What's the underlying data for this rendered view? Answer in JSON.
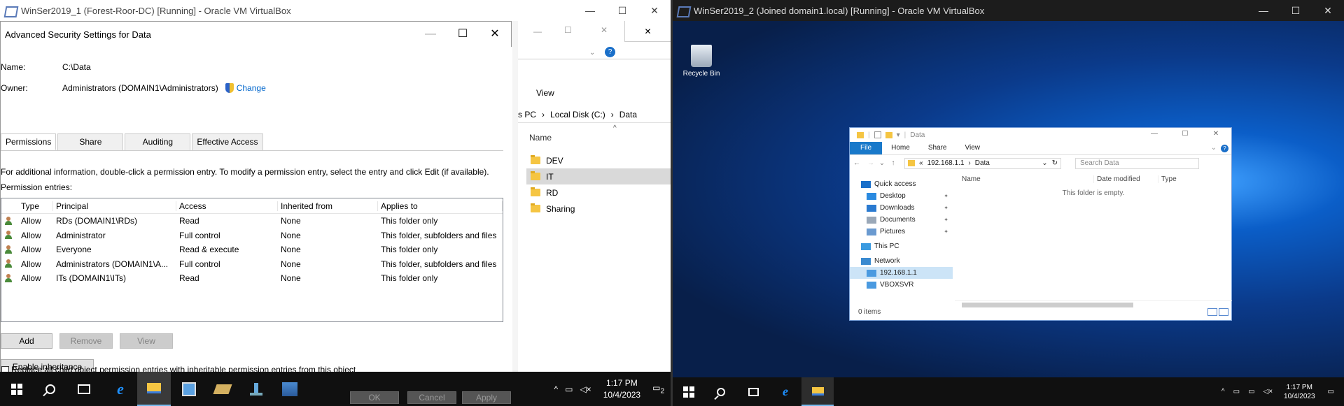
{
  "vm1": {
    "title": "WinSer2019_1 (Forest-Roor-DC) [Running] - Oracle VM VirtualBox",
    "dialog": {
      "title": "Advanced Security Settings for Data",
      "name_label": "Name:",
      "name_value": "C:\\Data",
      "owner_label": "Owner:",
      "owner_value": "Administrators (DOMAIN1\\Administrators)",
      "change_link": "Change",
      "tabs": [
        "Permissions",
        "Share",
        "Auditing",
        "Effective Access"
      ],
      "info_text": "For additional information, double-click a permission entry. To modify a permission entry, select the entry and click Edit (if available).",
      "entries_label": "Permission entries:",
      "columns": [
        "Type",
        "Principal",
        "Access",
        "Inherited from",
        "Applies to"
      ],
      "rows": [
        {
          "type": "Allow",
          "principal": "RDs (DOMAIN1\\RDs)",
          "access": "Read",
          "inherited": "None",
          "applies": "This folder only"
        },
        {
          "type": "Allow",
          "principal": "Administrator",
          "access": "Full control",
          "inherited": "None",
          "applies": "This folder, subfolders and files"
        },
        {
          "type": "Allow",
          "principal": "Everyone",
          "access": "Read & execute",
          "inherited": "None",
          "applies": "This folder only"
        },
        {
          "type": "Allow",
          "principal": "Administrators (DOMAIN1\\A...",
          "access": "Full control",
          "inherited": "None",
          "applies": "This folder, subfolders and files"
        },
        {
          "type": "Allow",
          "principal": "ITs (DOMAIN1\\ITs)",
          "access": "Read",
          "inherited": "None",
          "applies": "This folder only"
        }
      ],
      "add_label": "Add",
      "remove_label": "Remove",
      "view_label": "View",
      "enable_inheritance_label": "Enable inheritance",
      "replace_checkbox_label": "Replace all child object permission entries with inheritable permission entries from this object",
      "ok_label": "OK",
      "cancel_label": "Cancel",
      "apply_label": "Apply"
    },
    "explorer": {
      "view_tab": "View",
      "breadcrumb": [
        "s PC",
        "Local Disk (C:)",
        "Data"
      ],
      "name_header": "Name",
      "items": [
        "DEV",
        "IT",
        "RD",
        "Sharing"
      ],
      "selected_item": "IT"
    },
    "clock_time": "1:17 PM",
    "clock_date": "10/4/2023",
    "notif_count": "2"
  },
  "vm2": {
    "title": "WinSer2019_2 (Joined domain1.local) [Running] - Oracle VM VirtualBox",
    "recycle_bin": "Recycle Bin",
    "explorer": {
      "title": "Data",
      "ribbon": [
        "File",
        "Home",
        "Share",
        "View"
      ],
      "address": [
        "192.168.1.1",
        "Data"
      ],
      "search_placeholder": "Search Data",
      "nav": [
        {
          "label": "Quick access",
          "icon": "star-icon"
        },
        {
          "label": "Desktop",
          "icon": "desktop-icon",
          "pinned": true
        },
        {
          "label": "Downloads",
          "icon": "download-icon",
          "pinned": true
        },
        {
          "label": "Documents",
          "icon": "documents-icon",
          "pinned": true
        },
        {
          "label": "Pictures",
          "icon": "pictures-icon",
          "pinned": true
        },
        {
          "label": "This PC",
          "icon": "pc-icon"
        },
        {
          "label": "Network",
          "icon": "network-icon"
        },
        {
          "label": "192.168.1.1",
          "icon": "computer-icon",
          "selected": true
        },
        {
          "label": "VBOXSVR",
          "icon": "computer-icon"
        }
      ],
      "columns": [
        "Name",
        "Date modified",
        "Type"
      ],
      "empty_text": "This folder is empty.",
      "status": "0 items"
    },
    "clock_time": "1:17 PM",
    "clock_date": "10/4/2023"
  },
  "colors": {
    "accent": "#1979ca",
    "link": "#0066cc",
    "taskbar": "#101010"
  }
}
